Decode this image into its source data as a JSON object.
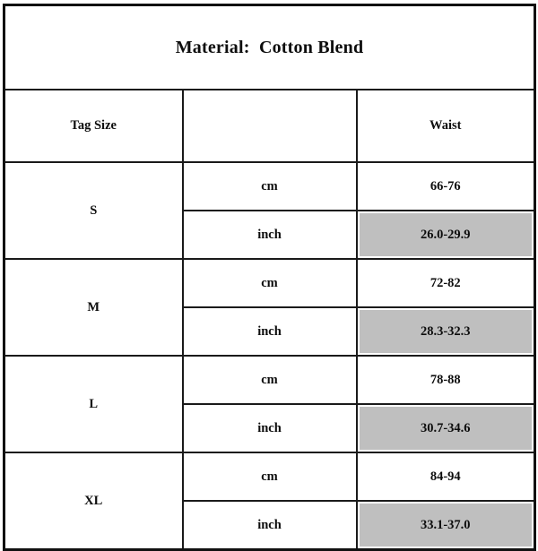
{
  "chart_data": {
    "type": "table",
    "title": "Material:  Cotton Blend",
    "columns": [
      "Tag Size",
      "",
      "Waist"
    ],
    "unit_labels": [
      "cm",
      "inch"
    ],
    "highlight_color": "#bfbfbf",
    "border_color": "#1a1a1a",
    "rows": [
      {
        "size": "S",
        "cm": "66-76",
        "inch": "26.0-29.9"
      },
      {
        "size": "M",
        "cm": "72-82",
        "inch": "28.3-32.3"
      },
      {
        "size": "L",
        "cm": "78-88",
        "inch": "30.7-34.6"
      },
      {
        "size": "XL",
        "cm": "84-94",
        "inch": "33.1-37.0"
      }
    ]
  },
  "table": {
    "title": "Material:  Cotton Blend",
    "header": {
      "tag_size": "Tag Size",
      "middle": "",
      "waist": "Waist"
    },
    "units": {
      "cm": "cm",
      "inch": "inch"
    },
    "sizes": [
      {
        "label": "S",
        "cm_value": "66-76",
        "inch_value": "26.0-29.9"
      },
      {
        "label": "M",
        "cm_value": "72-82",
        "inch_value": "28.3-32.3"
      },
      {
        "label": "L",
        "cm_value": "78-88",
        "inch_value": "30.7-34.6"
      },
      {
        "label": "XL",
        "cm_value": "84-94",
        "inch_value": "33.1-37.0"
      }
    ]
  }
}
